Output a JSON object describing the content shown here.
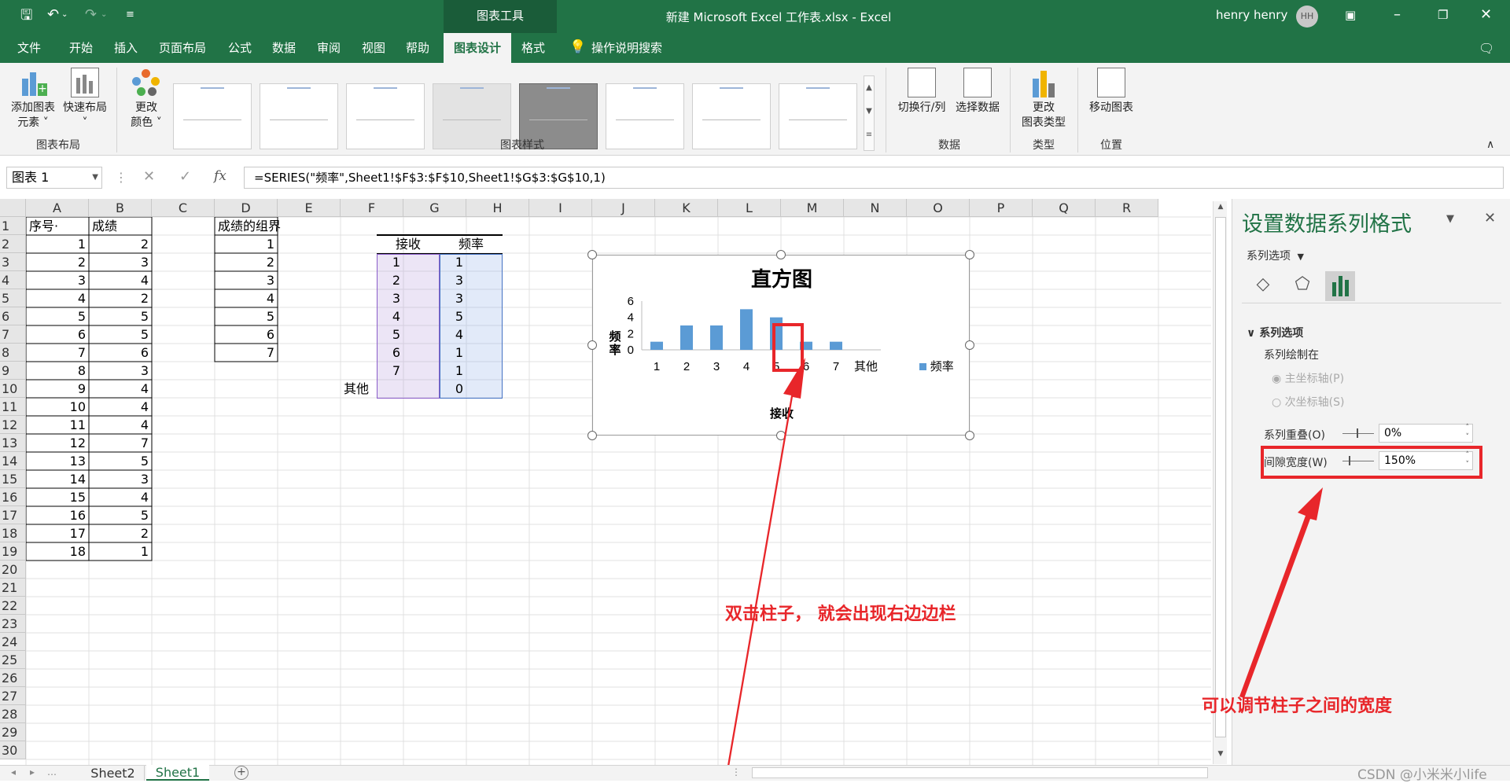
{
  "window": {
    "context_tab": "图表工具",
    "title": "新建 Microsoft Excel 工作表.xlsx  -  Excel",
    "user": "henry henry",
    "avatar": "HH"
  },
  "qat": {
    "icons": [
      "save-icon",
      "undo-icon",
      "redo-icon",
      "customize-icon"
    ]
  },
  "menu": {
    "items": [
      "文件",
      "开始",
      "插入",
      "页面布局",
      "公式",
      "数据",
      "审阅",
      "视图",
      "帮助",
      "图表设计",
      "格式"
    ],
    "active": "图表设计",
    "search": "操作说明搜索"
  },
  "ribbon": {
    "add_element_1": "添加图表",
    "add_element_2": "元素 ˅",
    "quick_layout_1": "快速布局",
    "quick_layout_2": "˅",
    "change_colors_1": "更改",
    "change_colors_2": "颜色 ˅",
    "group_layout": "图表布局",
    "group_styles": "图表样式",
    "switch_row_col": "切换行/列",
    "select_data": "选择数据",
    "group_data": "数据",
    "change_type_1": "更改",
    "change_type_2": "图表类型",
    "group_type": "类型",
    "move_chart": "移动图表",
    "group_location": "位置"
  },
  "formula_bar": {
    "name_box": "图表 1",
    "formula": "=SERIES(\"频率\",Sheet1!$F$3:$F$10,Sheet1!$G$3:$G$10,1)",
    "fx": "fx"
  },
  "columns": [
    "A",
    "B",
    "C",
    "D",
    "E",
    "F",
    "G",
    "H",
    "I",
    "J",
    "K",
    "L",
    "M",
    "N",
    "O",
    "P",
    "Q",
    "R"
  ],
  "rows": [
    "1",
    "2",
    "3",
    "4",
    "5",
    "6",
    "7",
    "8",
    "9",
    "10",
    "11",
    "12",
    "13",
    "14",
    "15",
    "16",
    "17",
    "18",
    "19",
    "20",
    "21",
    "22",
    "23",
    "24",
    "25",
    "26",
    "27",
    "28",
    "29",
    "30"
  ],
  "sheet": {
    "a1": "序号·",
    "b1": "成绩",
    "d1": "成绩的组界",
    "col_a": [
      "1",
      "2",
      "3",
      "4",
      "5",
      "6",
      "7",
      "8",
      "9",
      "10",
      "11",
      "12",
      "13",
      "14",
      "15",
      "16",
      "17",
      "18"
    ],
    "col_b": [
      "2",
      "3",
      "4",
      "2",
      "5",
      "5",
      "6",
      "3",
      "4",
      "4",
      "4",
      "7",
      "5",
      "3",
      "4",
      "5",
      "2",
      "1"
    ],
    "col_d": [
      "1",
      "2",
      "3",
      "4",
      "5",
      "6",
      "7"
    ],
    "f2": "接收",
    "g2": "频率",
    "col_f": [
      "1",
      "2",
      "3",
      "4",
      "5",
      "6",
      "7",
      "其他"
    ],
    "col_g": [
      "1",
      "3",
      "3",
      "5",
      "4",
      "1",
      "1",
      "0"
    ]
  },
  "chart_data": {
    "type": "bar",
    "title": "直方图",
    "xlabel": "接收",
    "ylabel": "频率",
    "categories": [
      "1",
      "2",
      "3",
      "4",
      "5",
      "6",
      "7",
      "其他"
    ],
    "series": [
      {
        "name": "频率",
        "values": [
          1,
          3,
          3,
          5,
          4,
          1,
          1,
          0
        ]
      }
    ],
    "yticks": [
      "0",
      "2",
      "4",
      "6"
    ],
    "ylim": [
      0,
      6
    ],
    "legend": "right",
    "bar_color": "#5b9bd5"
  },
  "pane": {
    "title": "设置数据系列格式",
    "options_dropdown": "系列选项",
    "section": "系列选项",
    "plot_on": "系列绘制在",
    "primary_axis": "主坐标轴(P)",
    "secondary_axis": "次坐标轴(S)",
    "overlap_label": "系列重叠(O)",
    "overlap_value": "0%",
    "gap_label": "间隙宽度(W)",
    "gap_value": "150%"
  },
  "tabs": {
    "sheet2": "Sheet2",
    "sheet1": "Sheet1"
  },
  "annotations": {
    "note1": "双击柱子， 就会出现右边边栏",
    "note2": "可以调节柱子之间的宽度",
    "watermark": "CSDN @小米米小life"
  },
  "colors": {
    "excel_green": "#217346",
    "annotation_red": "#e8262a",
    "bar": "#5b9bd5"
  }
}
